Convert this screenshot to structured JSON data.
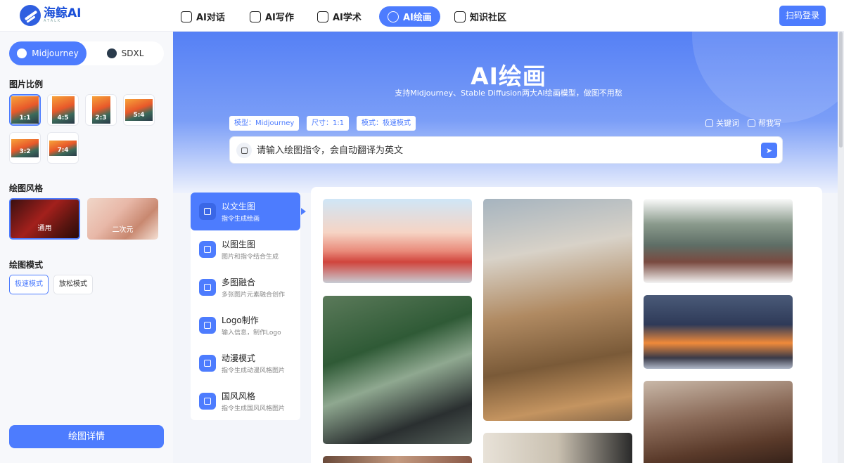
{
  "brand": {
    "name": "海鲸AI",
    "sub": "ATALK"
  },
  "nav": [
    {
      "label": "AI对话",
      "icon": "chat-bubble-icon"
    },
    {
      "label": "AI写作",
      "icon": "document-icon"
    },
    {
      "label": "AI学术",
      "icon": "graduation-cap-icon"
    },
    {
      "label": "AI绘画",
      "icon": "palette-icon",
      "active": true
    },
    {
      "label": "知识社区",
      "icon": "book-icon"
    }
  ],
  "login_label": "扫码登录",
  "sidebar": {
    "models": [
      "Midjourney",
      "SDXL"
    ],
    "selected_model": "Midjourney",
    "ratio_heading": "图片比例",
    "ratios": [
      "1:1",
      "4:5",
      "2:3",
      "5:4",
      "3:2",
      "7:4"
    ],
    "selected_ratio": "1:1",
    "style_heading": "绘图风格",
    "styles": [
      "通用",
      "二次元"
    ],
    "selected_style": "通用",
    "mode_heading": "绘图模式",
    "modes": [
      "极速模式",
      "放松模式"
    ],
    "selected_mode": "极速模式",
    "detail_button": "绘图详情"
  },
  "hero": {
    "title": "AI绘画",
    "subtitle": "支持Midjourney、Stable Diffusion两大AI绘画模型，做图不用愁",
    "tags": [
      "模型：Midjourney",
      "尺寸：1:1",
      "模式：极速模式"
    ],
    "keyword_link": "关键词",
    "help_link": "帮我写",
    "prompt_placeholder": "请输入绘图指令，会自动翻译为英文"
  },
  "create_modes": [
    {
      "title": "以文生图",
      "desc": "指令生成绘画",
      "active": true
    },
    {
      "title": "以图生图",
      "desc": "图片和指令结合生成"
    },
    {
      "title": "多图融合",
      "desc": "多张图片元素融合创作"
    },
    {
      "title": "Logo制作",
      "desc": "输入信息，制作Logo"
    },
    {
      "title": "动漫模式",
      "desc": "指令生成动漫风格图片"
    },
    {
      "title": "国风风格",
      "desc": "指令生成国风风格图片"
    }
  ],
  "colors": {
    "accent": "#4d7cfe",
    "hero_top": "#5580f5",
    "page_bg": "#f3f5fa"
  }
}
